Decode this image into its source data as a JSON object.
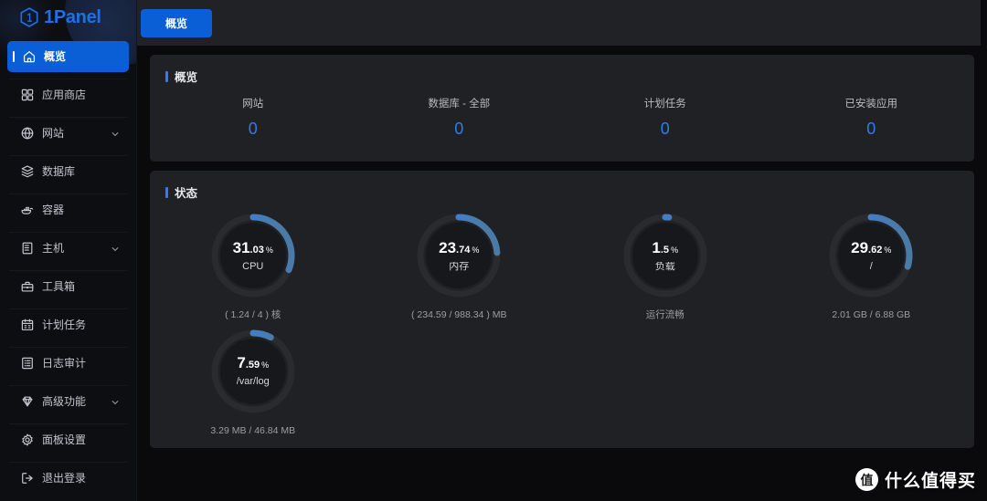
{
  "app": {
    "brand": "1Panel",
    "logo_mark": "hexagon-one-icon"
  },
  "sidebar": {
    "items": [
      {
        "label": "概览",
        "icon": "home-icon",
        "active": true,
        "chevron": false
      },
      {
        "label": "应用商店",
        "icon": "apps-grid-icon",
        "active": false,
        "chevron": false
      },
      {
        "label": "网站",
        "icon": "globe-icon",
        "active": false,
        "chevron": true
      },
      {
        "label": "数据库",
        "icon": "database-icon",
        "active": false,
        "chevron": false
      },
      {
        "label": "容器",
        "icon": "docker-icon",
        "active": false,
        "chevron": false
      },
      {
        "label": "主机",
        "icon": "server-icon",
        "active": false,
        "chevron": true
      },
      {
        "label": "工具箱",
        "icon": "toolbox-icon",
        "active": false,
        "chevron": false
      },
      {
        "label": "计划任务",
        "icon": "calendar-icon",
        "active": false,
        "chevron": false
      },
      {
        "label": "日志审计",
        "icon": "log-list-icon",
        "active": false,
        "chevron": false
      },
      {
        "label": "高级功能",
        "icon": "diamond-icon",
        "active": false,
        "chevron": true
      },
      {
        "label": "面板设置",
        "icon": "gear-icon",
        "active": false,
        "chevron": false
      },
      {
        "label": "退出登录",
        "icon": "logout-icon",
        "active": false,
        "chevron": false
      }
    ]
  },
  "tabs": [
    {
      "label": "概览",
      "active": true
    }
  ],
  "overview": {
    "title": "概览",
    "stats": [
      {
        "key": "网站",
        "value": "0"
      },
      {
        "key": "数据库 - 全部",
        "value": "0"
      },
      {
        "key": "计划任务",
        "value": "0"
      },
      {
        "key": "已安装应用",
        "value": "0"
      }
    ]
  },
  "status": {
    "title": "状态",
    "gauges": [
      {
        "int": "31",
        "dec": ".03",
        "unit": "%",
        "name": "CPU",
        "sub": "( 1.24 / 4 ) 核",
        "percent": 31.03
      },
      {
        "int": "23",
        "dec": ".74",
        "unit": "%",
        "name": "内存",
        "sub": "( 234.59 / 988.34 ) MB",
        "percent": 23.74
      },
      {
        "int": "1",
        "dec": ".5",
        "unit": "%",
        "name": "负载",
        "sub": "运行流畅",
        "percent": 1.5
      },
      {
        "int": "29",
        "dec": ".62",
        "unit": "%",
        "name": "/",
        "sub": "2.01 GB / 6.88 GB",
        "percent": 29.62
      },
      {
        "int": "7",
        "dec": ".59",
        "unit": "%",
        "name": "/var/log",
        "sub": "3.29 MB / 46.84 MB",
        "percent": 7.59
      }
    ]
  },
  "watermark": {
    "mark": "值",
    "text": "什么值得买"
  },
  "colors": {
    "accent": "#0b5fd6",
    "accent_text": "#2f7af5",
    "gauge_start": "#2f7af5",
    "gauge_end": "#4a7ba8",
    "track": "#2a2b2f",
    "card_bg": "#202124",
    "sidebar_bg": "#0d0e12",
    "page_bg": "#0a0a0c",
    "tabbar_bg": "#212225"
  }
}
